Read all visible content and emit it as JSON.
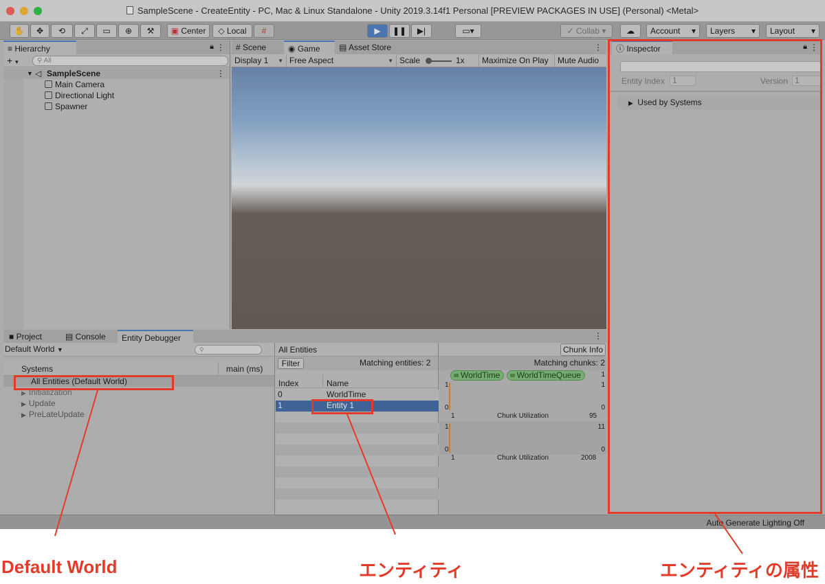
{
  "window": {
    "title": "SampleScene - CreateEntity - PC, Mac & Linux Standalone - Unity 2019.3.14f1 Personal [PREVIEW PACKAGES IN USE] (Personal) <Metal>"
  },
  "toolbar": {
    "pivot_label": "Center",
    "space_label": "Local",
    "collab_label": "Collab",
    "account_label": "Account",
    "layers_label": "Layers",
    "layout_label": "Layout"
  },
  "hierarchy": {
    "tab_label": "Hierarchy",
    "search_placeholder": "All",
    "scene_name": "SampleScene",
    "objects": [
      "Main Camera",
      "Directional Light",
      "Spawner"
    ]
  },
  "center_tabs": [
    "Scene",
    "Game",
    "Asset Store"
  ],
  "game_bar": {
    "display": "Display 1",
    "aspect": "Free Aspect",
    "scale_label": "Scale",
    "scale_value": "1x",
    "maximize": "Maximize On Play",
    "mute": "Mute Audio"
  },
  "inspector": {
    "tab_label": "Inspector",
    "entity_index_label": "Entity Index",
    "entity_index_value": "1",
    "version_label": "Version",
    "version_value": "1",
    "used_by_systems": "Used by Systems"
  },
  "bottom_tabs": [
    "Project",
    "Console",
    "Entity Debugger"
  ],
  "entity_debugger": {
    "world_select": "Default World",
    "systems_header": "Systems",
    "main_ms_header": "main (ms)",
    "system_rows": [
      "All Entities (Default World)",
      "Initialization",
      "Update",
      "PreLateUpdate"
    ],
    "all_entities_label": "All Entities",
    "chunk_info_label": "Chunk Info",
    "filter_label": "Filter",
    "matching_entities": "Matching entities: 2",
    "matching_chunks": "Matching chunks: 2",
    "index_header": "Index",
    "name_header": "Name",
    "entities": [
      {
        "index": "0",
        "name": "WorldTime"
      },
      {
        "index": "1",
        "name": "Entity 1"
      }
    ],
    "components": [
      "WorldTime",
      "WorldTimeQueue"
    ],
    "chunks": [
      {
        "count_top": "1",
        "y_top": "1",
        "y_bottom": "0",
        "x_start": "1",
        "caption": "Chunk Utilization",
        "x_end": "95",
        "right_top": "1",
        "right_bottom": "0"
      },
      {
        "count_top": "11",
        "y_top": "1",
        "y_bottom": "0",
        "x_start": "1",
        "caption": "Chunk Utilization",
        "x_end": "2008",
        "right_bottom": "0"
      }
    ]
  },
  "status_bar": {
    "text": "Auto Generate Lighting Off"
  },
  "annotations": {
    "default_world": "Default World",
    "entity": "エンティティ",
    "entity_attributes": "エンティティの属性"
  },
  "colors": {
    "annotation_red": "#e23b2a",
    "play_blue": "#4a7fc7",
    "selection_blue": "#3e6aa8",
    "component_green": "#7fc37a"
  }
}
